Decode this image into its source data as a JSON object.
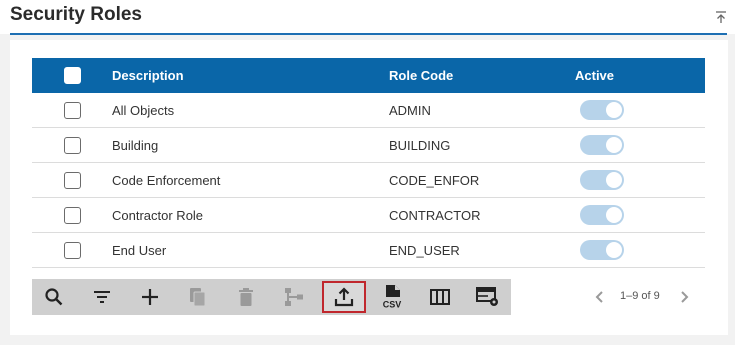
{
  "page": {
    "title": "Security Roles"
  },
  "table": {
    "columns": {
      "description": "Description",
      "role_code": "Role Code",
      "active": "Active"
    },
    "rows": [
      {
        "description": "All Objects",
        "role_code": "ADMIN",
        "active": true
      },
      {
        "description": "Building",
        "role_code": "BUILDING",
        "active": true
      },
      {
        "description": "Code Enforcement",
        "role_code": "CODE_ENFOR",
        "active": true
      },
      {
        "description": "Contractor Role",
        "role_code": "CONTRACTOR",
        "active": true
      },
      {
        "description": "End User",
        "role_code": "END_USER",
        "active": true
      }
    ]
  },
  "toolbar": {
    "buttons": [
      {
        "icon": "search-icon",
        "enabled": true
      },
      {
        "icon": "filter-icon",
        "enabled": true
      },
      {
        "icon": "plus-icon",
        "enabled": true
      },
      {
        "icon": "copy-icon",
        "enabled": false
      },
      {
        "icon": "delete-icon",
        "enabled": false
      },
      {
        "icon": "hierarchy-icon",
        "enabled": false
      },
      {
        "icon": "upload-icon",
        "enabled": true,
        "selected": true
      },
      {
        "icon": "csv-icon",
        "enabled": true,
        "label": "CSV"
      },
      {
        "icon": "columns-icon",
        "enabled": true
      },
      {
        "icon": "table-settings-icon",
        "enabled": true
      }
    ]
  },
  "pager": {
    "text": "1–9 of 9"
  },
  "colors": {
    "header": "#0a66a8",
    "accent": "#1e6fb3",
    "toggle": "#b7d3ea",
    "highlight": "#c0272d"
  }
}
